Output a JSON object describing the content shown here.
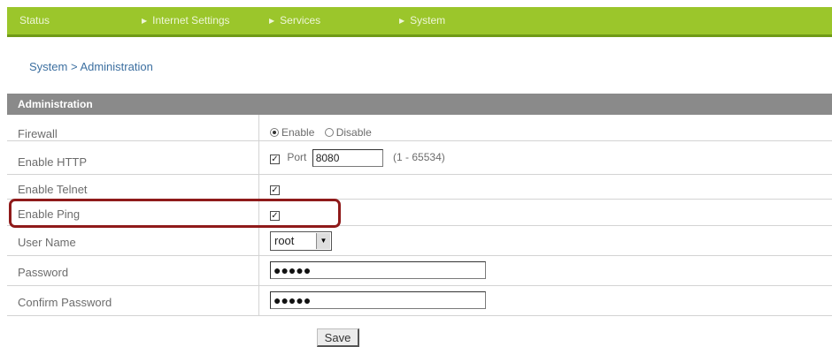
{
  "nav": {
    "status": "Status",
    "internet_settings": "Internet Settings",
    "services": "Services",
    "system": "System"
  },
  "breadcrumb": "System > Administration",
  "section_title": "Administration",
  "rows": {
    "firewall": {
      "label": "Firewall",
      "enable": "Enable",
      "disable": "Disable",
      "selected": "Enable"
    },
    "http": {
      "label": "Enable HTTP",
      "checked": true,
      "port_label": "Port",
      "port_value": "8080",
      "range": "(1 - 65534)"
    },
    "telnet": {
      "label": "Enable Telnet",
      "checked": true
    },
    "ping": {
      "label": "Enable Ping",
      "checked": true
    },
    "username": {
      "label": "User Name",
      "value": "root"
    },
    "password": {
      "label": "Password",
      "value": "●●●●●"
    },
    "confirm_password": {
      "label": "Confirm Password",
      "value": "●●●●●"
    }
  },
  "save_label": "Save",
  "colors": {
    "topbar": "#9bc62b",
    "section_header": "#8a8a8a",
    "highlight": "#8f1a1a",
    "link": "#3c6fa0"
  }
}
